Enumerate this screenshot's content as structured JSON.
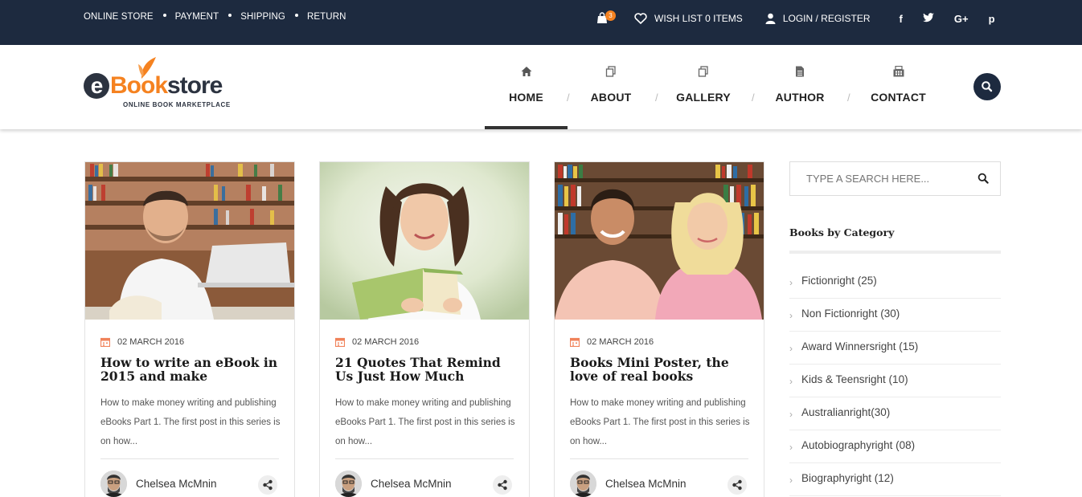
{
  "topbar": {
    "links": [
      "ONLINE STORE",
      "PAYMENT",
      "SHIPPING",
      "RETURN"
    ],
    "cart_count": "3",
    "wishlist_label": "WISH LIST 0 ITEMS",
    "login_label": "LOGIN / REGISTER",
    "social": [
      "f",
      "t",
      "G+",
      "p"
    ]
  },
  "logo": {
    "e": "e",
    "book": "Book",
    "store": "store",
    "tagline": "ONLINE BOOK MARKETPLACE"
  },
  "nav": {
    "items": [
      {
        "label": "HOME",
        "icon": "home-icon"
      },
      {
        "label": "ABOUT",
        "icon": "copy-icon"
      },
      {
        "label": "GALLERY",
        "icon": "copy-icon"
      },
      {
        "label": "AUTHOR",
        "icon": "document-icon"
      },
      {
        "label": "CONTACT",
        "icon": "fax-icon"
      }
    ],
    "separator": "/"
  },
  "posts": [
    {
      "date": "02 MARCH 2016",
      "title": "How to write an eBook in 2015 and make",
      "excerpt": "How to make money writing and publishing eBooks Part 1. The first post in this series is on how...",
      "author": "Chelsea McMnin"
    },
    {
      "date": "02 MARCH 2016",
      "title": "21 Quotes That Remind Us Just How Much",
      "excerpt": "How to make money writing and publishing eBooks Part 1. The first post in this series is on how...",
      "author": "Chelsea McMnin"
    },
    {
      "date": "02 MARCH 2016",
      "title": "Books Mini Poster, the love of real books",
      "excerpt": "How to make money writing and publishing eBooks Part 1. The first post in this series is on how...",
      "author": "Chelsea McMnin"
    }
  ],
  "sidebar": {
    "search_placeholder": "TYPE A SEARCH HERE...",
    "category_title": "Books by Category",
    "categories": [
      "Fictionright (25)",
      "Non Fictionright (30)",
      "Award Winnersright (15)",
      "Kids & Teensright (10)",
      "Australianright(30)",
      "Autobiographyright (08)",
      "Biographyright (12)"
    ]
  },
  "colors": {
    "topbar_bg": "#1d2a3f",
    "accent": "#f58220",
    "calendar": "#f0825a"
  }
}
